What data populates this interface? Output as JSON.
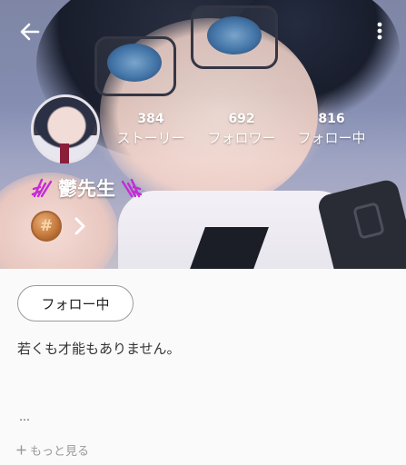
{
  "icons": {
    "back": "arrow-left-icon",
    "more": "more-vertical-icon",
    "chevron": "chevron-right-icon",
    "medal": "medal-icon",
    "decoration": "sparkle-decoration-icon",
    "plus": "plus-icon"
  },
  "profile": {
    "name": "鬱先生",
    "medal_glyph": "#"
  },
  "stats": [
    {
      "value": "384",
      "label": "ストーリー"
    },
    {
      "value": "692",
      "label": "フォロワー"
    },
    {
      "value": "816",
      "label": "フォロー中"
    }
  ],
  "actions": {
    "follow_button": "フォロー中"
  },
  "bio": {
    "text": "若くも才能もありません。",
    "ellipsis": "…",
    "see_more": "もっと見る"
  },
  "colors": {
    "name_decoration": "#c52bd6",
    "medal": "#c57a3d"
  }
}
